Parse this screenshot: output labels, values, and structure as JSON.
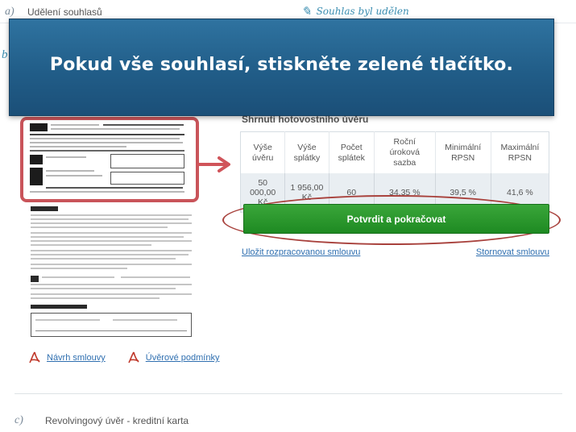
{
  "steps": {
    "a": {
      "letter": "a)",
      "label": "Udělení souhlasů",
      "status": "Souhlas byl udělen"
    },
    "b": {
      "letter": "b"
    },
    "c": {
      "letter": "c)",
      "label": "Revolvingový úvěr - kreditní karta"
    }
  },
  "overlay": {
    "instruction": "Pokud vše souhlasí, stiskněte zelené tlačítko."
  },
  "summary": {
    "title": "Shrnutí hotovostního úvěru",
    "columns": [
      "Výše úvěru",
      "Výše splátky",
      "Počet splátek",
      "Roční úroková sazba",
      "Minimální RPSN",
      "Maximální RPSN"
    ],
    "values": [
      "50 000,00 Kč",
      "1 956,00 Kč",
      "60",
      "34,35 %",
      "39,5 %",
      "41,6 %"
    ]
  },
  "actions": {
    "confirm_label": "Potvrdit a pokračovat",
    "save_label": "Uložit rozpracovanou smlouvu",
    "cancel_label": "Stornovat smlouvu"
  },
  "documents": {
    "contract_label": "Návrh smlouvy",
    "terms_label": "Úvěrové podmínky"
  },
  "colors": {
    "banner": "#215d88",
    "confirm": "#2a962d",
    "highlight": "#c9545a",
    "link": "#2f6fb0"
  },
  "icons": {
    "status": "leaf-icon",
    "doc": "pdf-icon"
  }
}
